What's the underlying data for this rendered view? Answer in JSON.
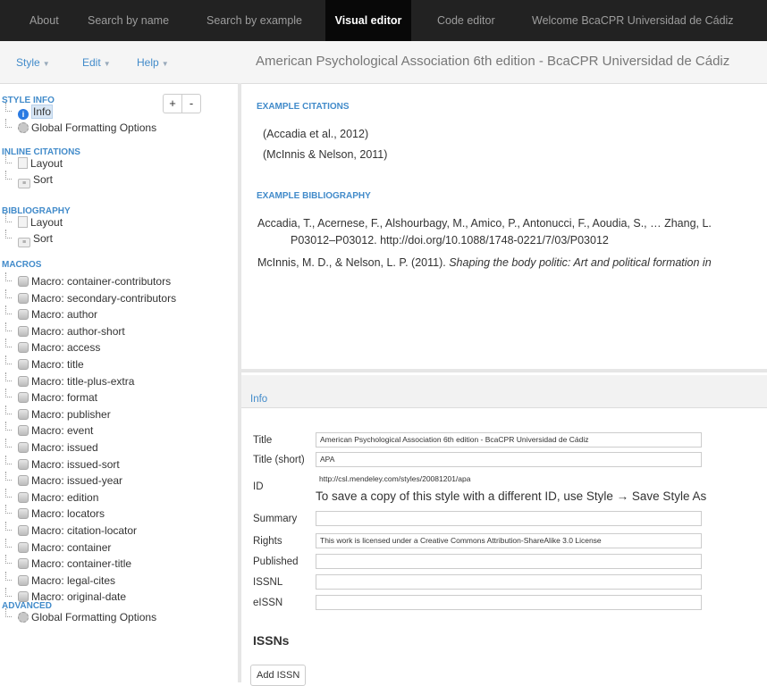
{
  "nav": {
    "items": [
      "About",
      "Search by name",
      "Search by example",
      "Visual editor",
      "Code editor",
      "Welcome BcaCPR Universidad de Cádiz"
    ],
    "active": "Visual editor"
  },
  "toolbar": {
    "menus": [
      "Style",
      "Edit",
      "Help"
    ],
    "style_title": "American Psychological Association 6th edition - BcaCPR Universidad de Cádiz"
  },
  "tree": {
    "style_info": {
      "heading": "STYLE INFO",
      "add": "+",
      "remove": "-",
      "items": [
        "Info",
        "Global Formatting Options"
      ]
    },
    "inline": {
      "heading": "INLINE CITATIONS",
      "items": [
        "Layout",
        "Sort"
      ]
    },
    "bibliography": {
      "heading": "BIBLIOGRAPHY",
      "items": [
        "Layout",
        "Sort"
      ]
    },
    "macros": {
      "heading": "MACROS",
      "items": [
        "Macro: container-contributors",
        "Macro: secondary-contributors",
        "Macro: author",
        "Macro: author-short",
        "Macro: access",
        "Macro: title",
        "Macro: title-plus-extra",
        "Macro: format",
        "Macro: publisher",
        "Macro: event",
        "Macro: issued",
        "Macro: issued-sort",
        "Macro: issued-year",
        "Macro: edition",
        "Macro: locators",
        "Macro: citation-locator",
        "Macro: container",
        "Macro: container-title",
        "Macro: legal-cites",
        "Macro: original-date"
      ]
    },
    "advanced": {
      "heading": "ADVANCED",
      "items": [
        "Global Formatting Options"
      ]
    }
  },
  "examples": {
    "citations_heading": "EXAMPLE CITATIONS",
    "citations": [
      "(Accadia et al., 2012)",
      "(McInnis & Nelson, 2011)"
    ],
    "bibliography_heading": "EXAMPLE BIBLIOGRAPHY",
    "bib1_line1": "Accadia, T., Acernese, F., Alshourbagy, M., Amico, P., Antonucci, F., Aoudia, S., … Zhang, L.",
    "bib1_line2": "P03012–P03012. http://doi.org/10.1088/1748-0221/7/03/P03012",
    "bib2_plain": "McInnis, M. D., & Nelson, L. P. (2011). ",
    "bib2_italic": "Shaping the body politic: Art and political formation in"
  },
  "info": {
    "tab": "Info",
    "fields": {
      "title": {
        "label": "Title",
        "value": "American Psychological Association 6th edition - BcaCPR Universidad de Cádiz"
      },
      "title_short": {
        "label": "Title (short)",
        "value": "APA"
      },
      "id": {
        "label": "ID",
        "value": "http://csl.mendeley.com/styles/20081201/apa",
        "note": "To save a copy of this style with a different ID, use Style → Save Style As"
      },
      "summary": {
        "label": "Summary",
        "value": ""
      },
      "rights": {
        "label": "Rights",
        "value": "This work is licensed under a Creative Commons Attribution-ShareAlike 3.0 License"
      },
      "published": {
        "label": "Published",
        "value": ""
      },
      "issnl": {
        "label": "ISSNL",
        "value": ""
      },
      "eissn": {
        "label": "eISSN",
        "value": ""
      }
    },
    "issns_heading": "ISSNs",
    "add_issn": "Add ISSN"
  },
  "colors": {
    "nav_bg": "#222222",
    "nav_active": "#080808",
    "accent": "#428bca"
  }
}
